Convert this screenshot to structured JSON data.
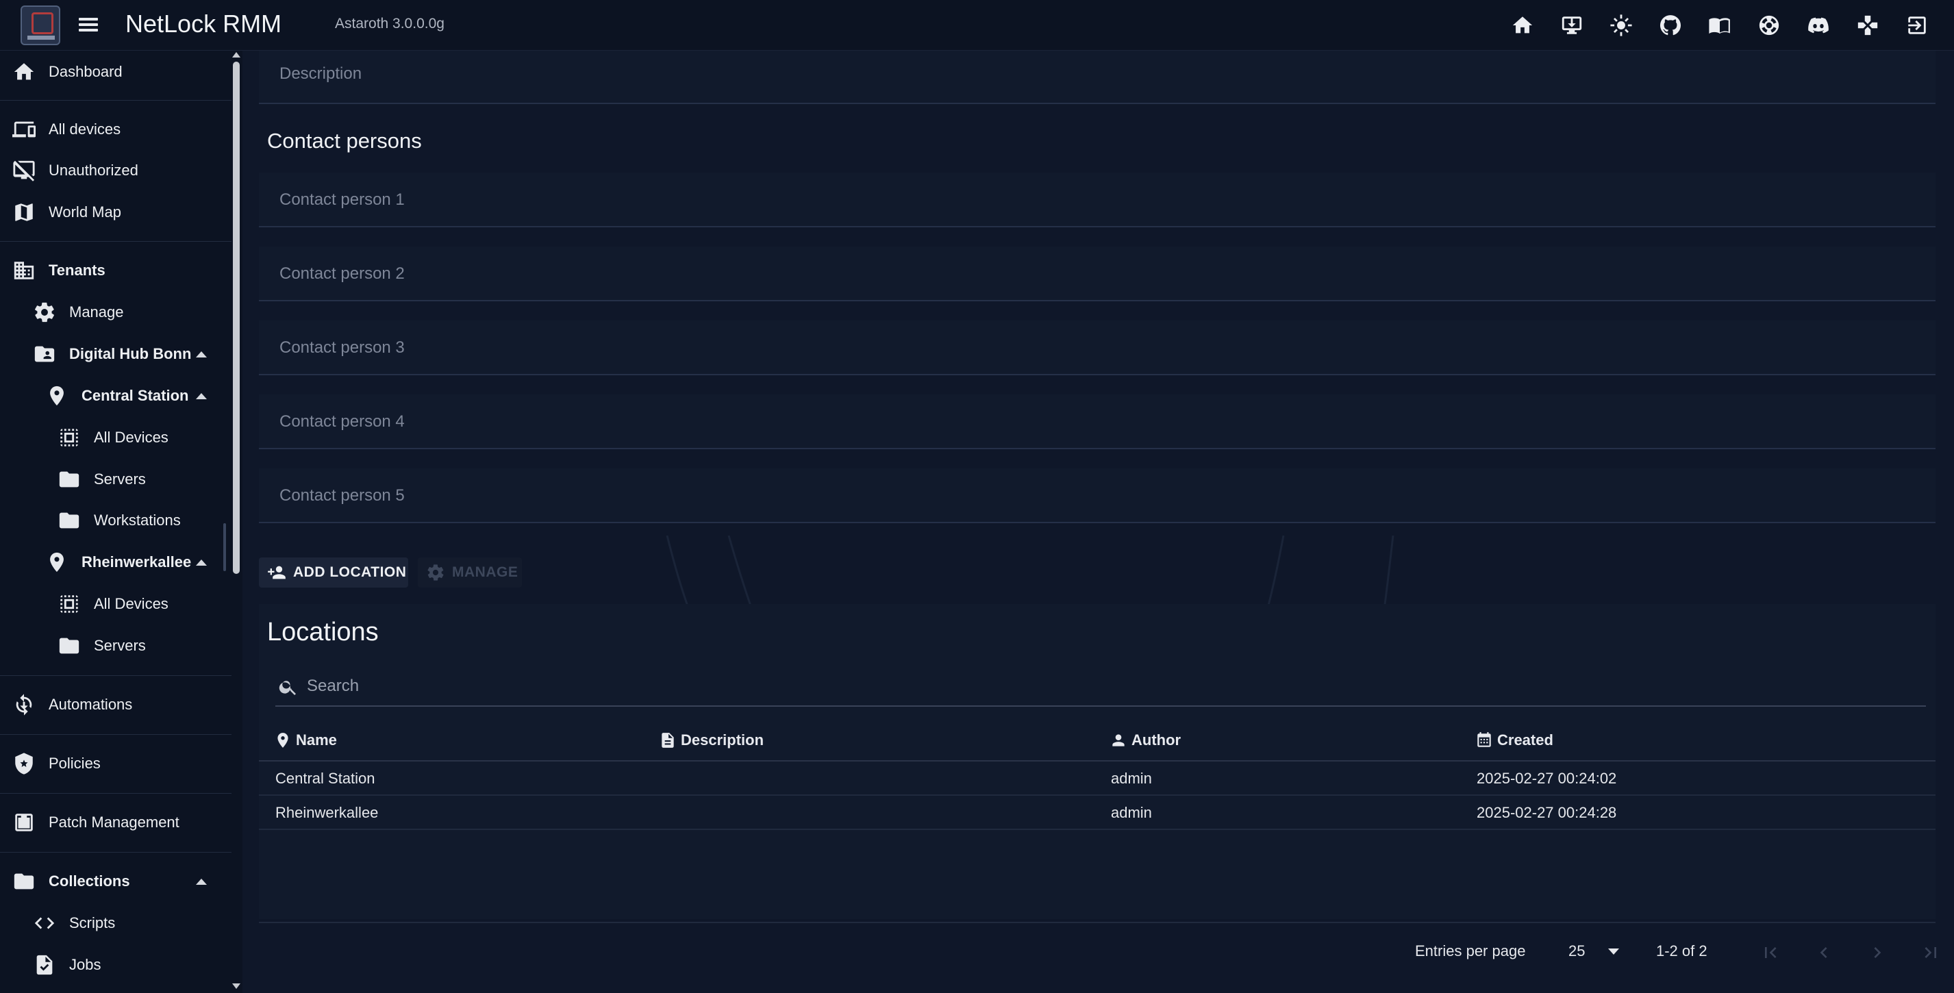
{
  "app": {
    "title": "NetLock RMM",
    "version": "Astaroth 3.0.0.0g"
  },
  "topbar_icons": [
    "home-icon",
    "download-icon",
    "brightness-icon",
    "github-icon",
    "docs-icon",
    "support-icon",
    "discord-icon",
    "remote-control-icon",
    "logout-icon"
  ],
  "sidebar": {
    "items": [
      {
        "label": "Dashboard",
        "icon": "home-icon"
      },
      {
        "label": "All devices",
        "icon": "devices-icon"
      },
      {
        "label": "Unauthorized",
        "icon": "unauthorized-icon"
      },
      {
        "label": "World Map",
        "icon": "map-icon"
      },
      {
        "label": "Tenants",
        "icon": "tenants-icon"
      },
      {
        "label": "Manage",
        "icon": "gear-icon"
      },
      {
        "label": "Digital Hub Bonn",
        "icon": "folder-shared-icon"
      },
      {
        "label": "Central Station",
        "icon": "location-pin-icon"
      },
      {
        "label": "All Devices",
        "icon": "select-all-icon"
      },
      {
        "label": "Servers",
        "icon": "folder-icon"
      },
      {
        "label": "Workstations",
        "icon": "folder-icon"
      },
      {
        "label": "Rheinwerkallee",
        "icon": "location-pin-icon"
      },
      {
        "label": "All Devices",
        "icon": "select-all-icon"
      },
      {
        "label": "Servers",
        "icon": "folder-icon"
      },
      {
        "label": "Automations",
        "icon": "automation-icon"
      },
      {
        "label": "Policies",
        "icon": "policy-shield-icon"
      },
      {
        "label": "Patch Management",
        "icon": "patch-icon"
      },
      {
        "label": "Collections",
        "icon": "folder-icon"
      },
      {
        "label": "Scripts",
        "icon": "code-icon"
      },
      {
        "label": "Jobs",
        "icon": "job-file-icon"
      }
    ]
  },
  "form": {
    "description_placeholder": "Description",
    "contact_title": "Contact persons",
    "contacts": [
      "Contact person 1",
      "Contact person 2",
      "Contact person 3",
      "Contact person 4",
      "Contact person 5"
    ],
    "add_location_label": "ADD LOCATION",
    "manage_label": "MANAGE"
  },
  "locations": {
    "title": "Locations",
    "search_placeholder": "Search",
    "columns": [
      "Name",
      "Description",
      "Author",
      "Created"
    ],
    "rows": [
      {
        "name": "Central Station",
        "description": "",
        "author": "admin",
        "created": "2025-02-27 00:24:02"
      },
      {
        "name": "Rheinwerkallee",
        "description": "",
        "author": "admin",
        "created": "2025-02-27 00:24:28"
      }
    ],
    "footer": {
      "entries_label": "Entries per page",
      "per_page": "25",
      "range": "1-2 of 2"
    }
  },
  "colors": {
    "background": "#0f1729",
    "appbar": "#0c1322",
    "surface": "#111a2c"
  }
}
